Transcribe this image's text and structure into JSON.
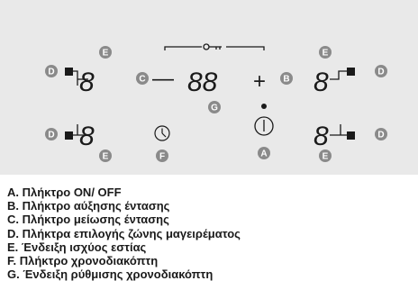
{
  "panel": {
    "digits": {
      "single": "8",
      "double": "88"
    },
    "symbols": {
      "minus": "—",
      "plus": "+"
    },
    "callouts": {
      "A": "A",
      "B": "B",
      "C": "C",
      "D": "D",
      "E": "E",
      "F": "F",
      "G": "G"
    },
    "icons": {
      "lock": "lock-key-icon",
      "power": "power-icon",
      "timer": "clock-icon",
      "zone": "zone-square-icon"
    },
    "colors": {
      "panel_bg": "#e9e9e9",
      "callout_bg": "#8a8a8a",
      "ink": "#1a1a1a"
    }
  },
  "legend": [
    "A. Πλήκτρο ON/ OFF",
    "B. Πλήκτρο αύξησης έντασης",
    "C. Πλήκτρο μείωσης έντασης",
    "D. Πλήκτρα επιλογής ζώνης μαγειρέματος",
    "E. Ένδειξη ισχύος εστίας",
    "F. Πλήκτρο χρονοδιακόπτη",
    "G. Ένδειξη ρύθμισης χρονοδιακόπτη"
  ]
}
